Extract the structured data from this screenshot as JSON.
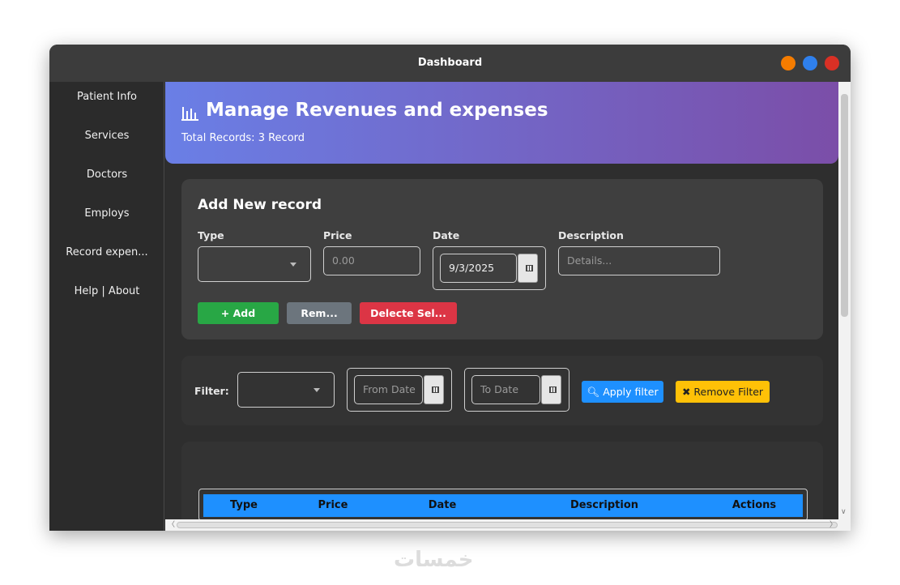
{
  "window": {
    "title": "Dashboard",
    "controls": {
      "min_color": "#f57c00",
      "max_color": "#2f80ed",
      "close_color": "#d93025"
    }
  },
  "sidebar": {
    "items": [
      {
        "label": "Patient Info"
      },
      {
        "label": "Services"
      },
      {
        "label": "Doctors"
      },
      {
        "label": "Employs"
      },
      {
        "label": "Record expen..."
      },
      {
        "label": "Help | About"
      }
    ]
  },
  "header": {
    "icon": "bar-chart-icon",
    "title": "Manage Revenues and expenses",
    "subtitle": "Total Records: 3 Record"
  },
  "add_form": {
    "title": "Add New record",
    "type_label": "Type",
    "price_label": "Price",
    "price_placeholder": "0.00",
    "date_label": "Date",
    "date_value": "9/3/2025",
    "description_label": "Description",
    "description_placeholder": "Details...",
    "add_button": "+ Add",
    "remove_button": "Rem...",
    "delete_button": "Delecte Sel..."
  },
  "filter": {
    "label": "Filter:",
    "from_placeholder": "From Date",
    "to_placeholder": "To Date",
    "apply_button": "Apply filter",
    "remove_button": "Remove Filter"
  },
  "table": {
    "columns": [
      "Type",
      "Price",
      "Date",
      "Description",
      "Actions"
    ]
  },
  "colors": {
    "accent_blue": "#1e90ff",
    "add_green": "#28a745",
    "delete_red": "#dc3545",
    "warning_yellow": "#ffc107",
    "secondary_gray": "#6c757d"
  },
  "watermark": "خمسات"
}
